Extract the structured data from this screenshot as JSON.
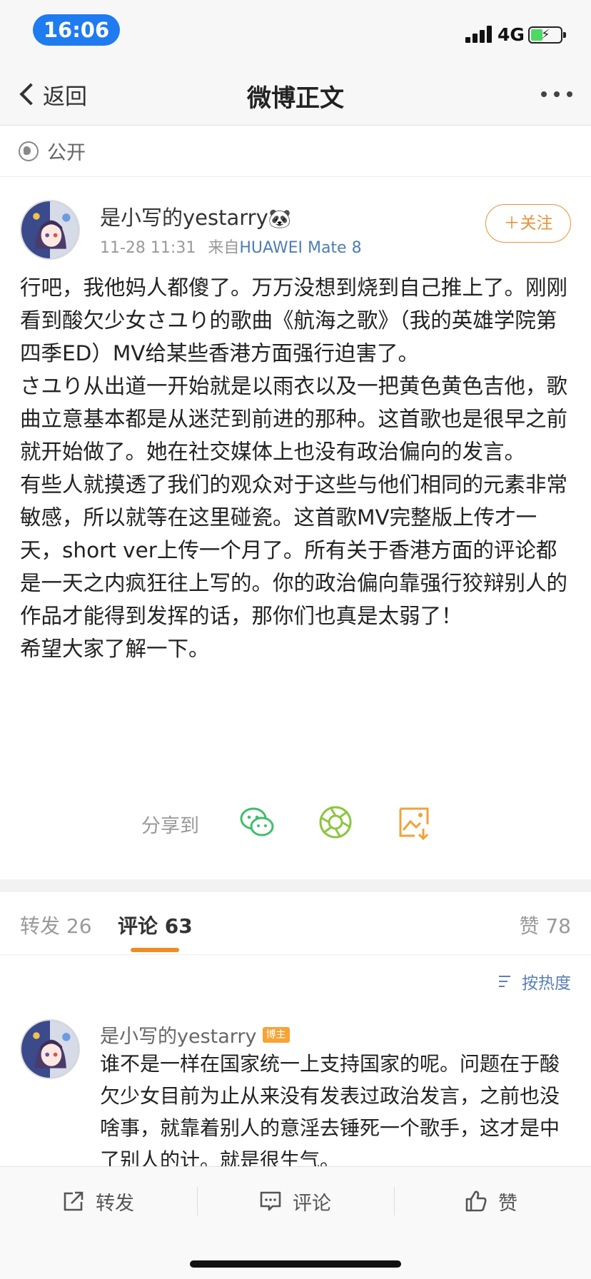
{
  "status": {
    "time": "16:06",
    "network": "4G"
  },
  "nav": {
    "back_label": "返回",
    "title": "微博正文",
    "more_icon": "more-dots-icon"
  },
  "visibility": {
    "label": "公开",
    "icon": "globe-icon"
  },
  "post": {
    "author": "是小写的yestarry",
    "author_emoji": "🐼",
    "time": "11-28 11:31",
    "source_prefix": "来自",
    "device": "HUAWEI Mate 8",
    "follow_label": "＋关注",
    "paragraphs": [
      "行吧，我他妈人都傻了。万万没想到烧到自己推上了。刚刚看到酸欠少女さユり的歌曲《航海之歌》（我的英雄学院第四季ED）MV给某些香港方面强行迫害了。",
      "さユり从出道一开始就是以雨衣以及一把黄色黄色吉他，歌曲立意基本都是从迷茫到前进的那种。这首歌也是很早之前就开始做了。她在社交媒体上也没有政治偏向的发言。",
      "有些人就摸透了我们的观众对于这些与他们相同的元素非常敏感，所以就等在这里碰瓷。这首歌MV完整版上传才一天，short ver上传一个月了。所有关于香港方面的评论都是一天之内疯狂往上写的。你的政治偏向靠强行狡辩别人的作品才能得到发挥的话，那你们也真是太弱了！",
      "希望大家了解一下。"
    ]
  },
  "share": {
    "label": "分享到",
    "targets": [
      "wechat-icon",
      "moments-icon",
      "save-image-icon"
    ]
  },
  "tabs": {
    "repost": {
      "label": "转发",
      "count": "26"
    },
    "comment": {
      "label": "评论",
      "count": "63"
    },
    "like": {
      "label": "赞",
      "count": "78"
    }
  },
  "sort": {
    "label": "按热度"
  },
  "comment": {
    "author": "是小写的yestarry",
    "badge": "博主",
    "text": "谁不是一样在国家统一上支持国家的呢。问题在于酸欠少女目前为止从来没有发表过政治发言，之前也没啥事，就靠着别人的意淫去锤死一个歌手，这才是中了别人的计。就是很生气。"
  },
  "bottom_bar": {
    "repost": "转发",
    "comment": "评论",
    "like": "赞"
  },
  "colors": {
    "accent": "#f08b24",
    "link": "#4d7cb5",
    "time_pill": "#1f7bf0"
  }
}
